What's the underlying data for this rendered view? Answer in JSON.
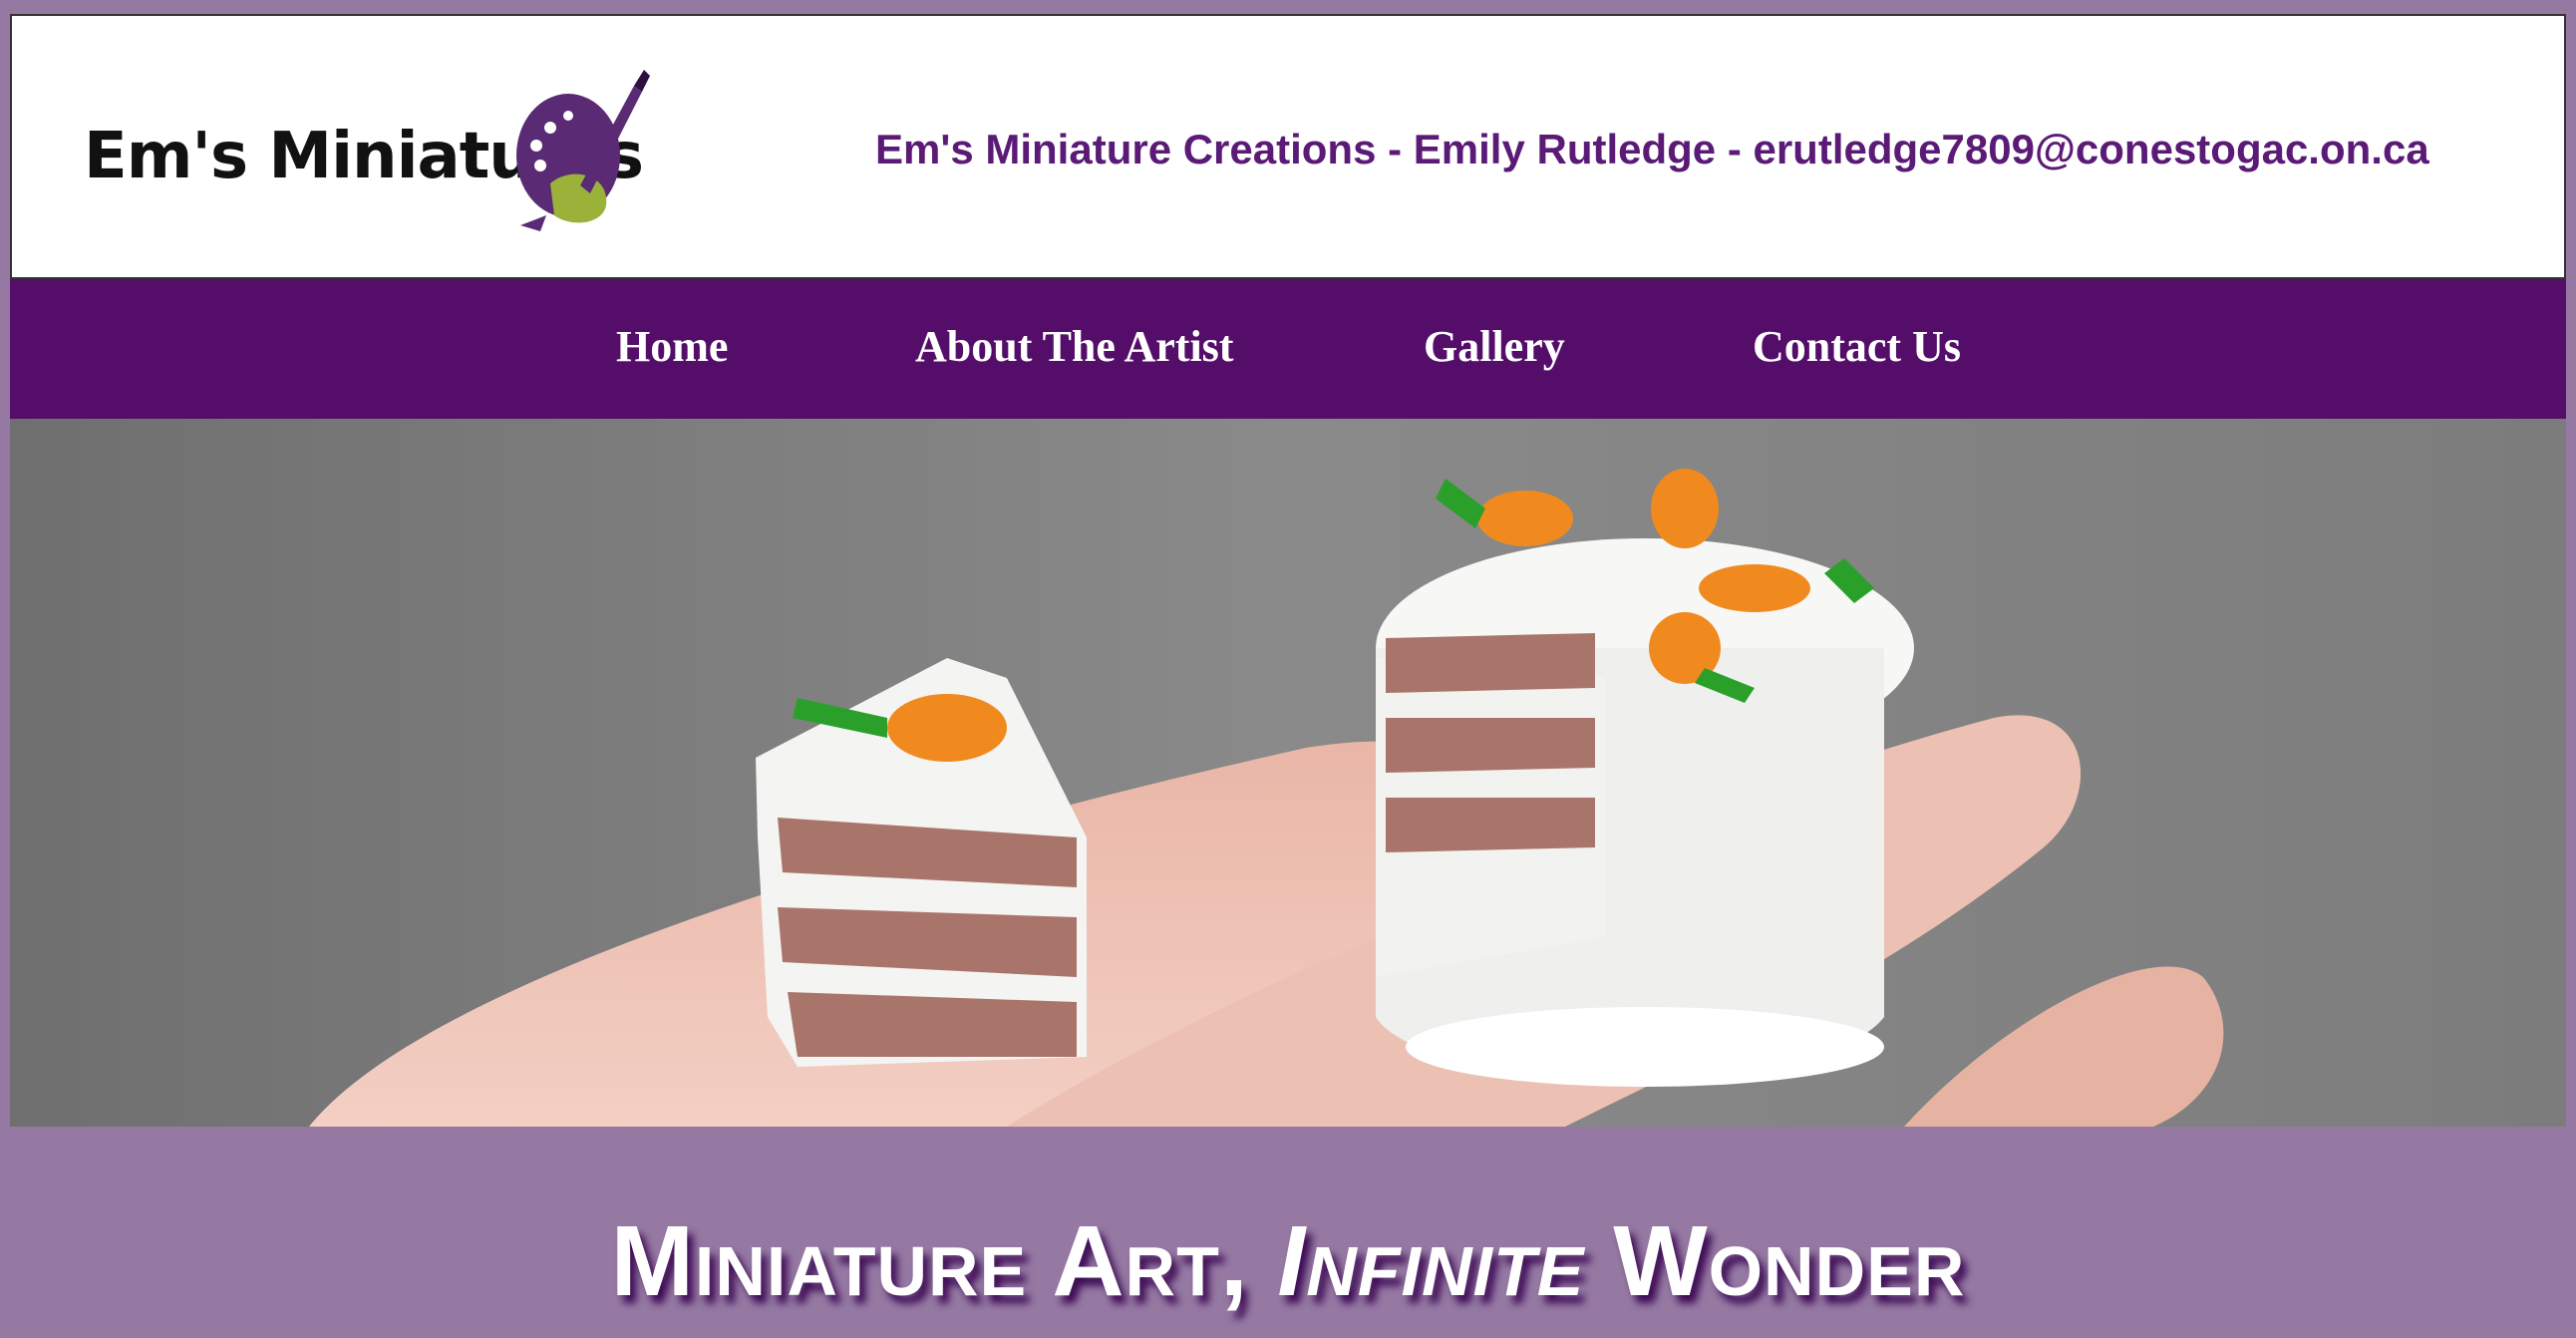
{
  "theme": {
    "background": "#9579a3",
    "nav_bg": "#540e6a",
    "tagline_color": "#5a1a76",
    "accent_green": "#9ab23a"
  },
  "logo": {
    "text": "Em's Miniatures",
    "icon": "palette-brush-icon"
  },
  "header": {
    "tagline": "Em's Miniature Creations - Emily Rutledge - erutledge7809@conestogac.on.ca"
  },
  "nav": {
    "items": [
      {
        "label": "Home"
      },
      {
        "label": "About The Artist"
      },
      {
        "label": "Gallery"
      },
      {
        "label": "Contact Us"
      }
    ]
  },
  "hero": {
    "image": "miniature-carrot-cake-photo"
  },
  "headline": {
    "part1": "Miniature Art, ",
    "part2": "Infinite",
    "part3": " Wonder"
  }
}
